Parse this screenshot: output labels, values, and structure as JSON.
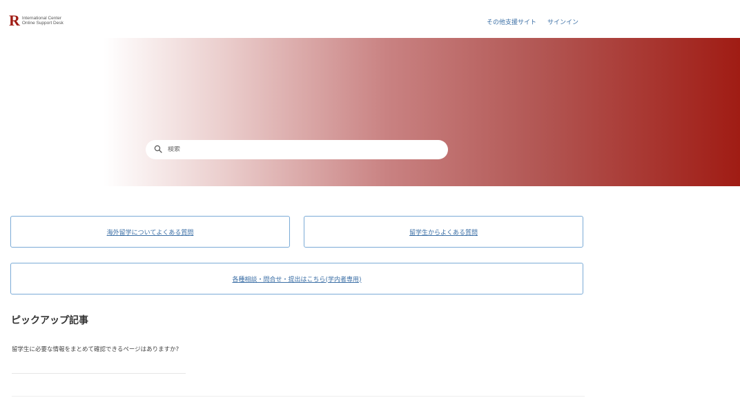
{
  "header": {
    "logo_mark": "R",
    "logo_line1": "International Center",
    "logo_line2": "Online Support Desk",
    "nav": [
      {
        "label": "その他支援サイト"
      },
      {
        "label": "サインイン"
      }
    ]
  },
  "hero": {
    "search_placeholder": "検索"
  },
  "categories": [
    {
      "label": "海外留学についてよくある質問"
    },
    {
      "label": "留学生からよくある質問"
    },
    {
      "label": "各種相談・問合せ・提出はこちら(学内者専用)"
    }
  ],
  "pickup": {
    "title": "ピックアップ記事",
    "items": [
      {
        "title": "留学生に必要な情報をまとめて確認できるページはありますか?"
      }
    ]
  },
  "colors": {
    "brand": "#a01c14",
    "link": "#3a6ea5",
    "button_border": "#7aaad6"
  }
}
